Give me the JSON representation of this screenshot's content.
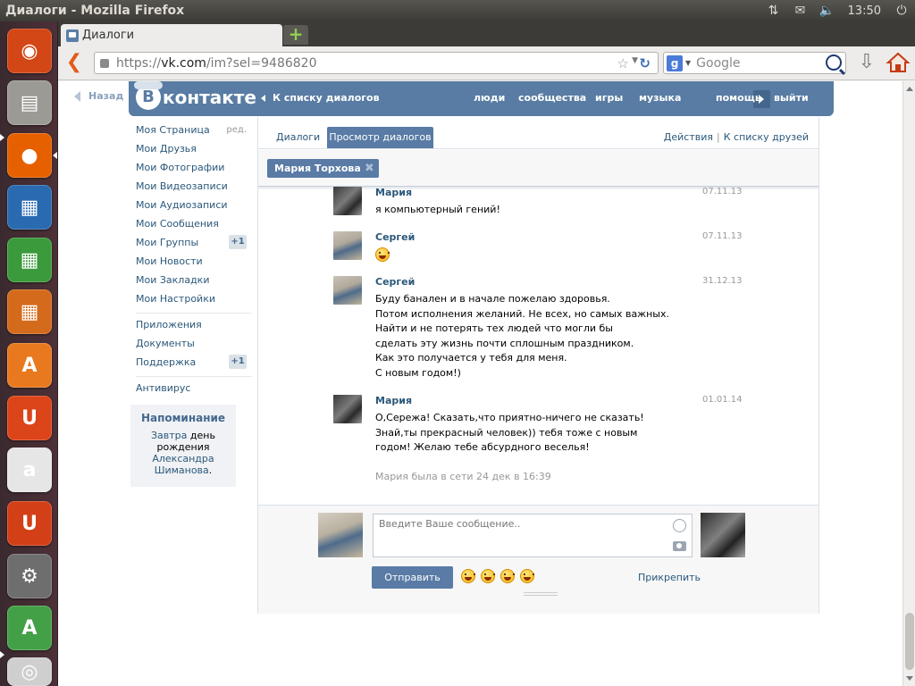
{
  "window": {
    "title": "Диалоги - Mozilla Firefox"
  },
  "tray": {
    "clock": "13:50"
  },
  "launcher": {
    "items": [
      {
        "name": "ubuntu-dash-icon",
        "bg": "#d34615",
        "glyph": "◉"
      },
      {
        "name": "files-icon",
        "bg": "#9c9a94",
        "glyph": "▤"
      },
      {
        "name": "firefox-icon",
        "bg": "#e66000",
        "glyph": "●"
      },
      {
        "name": "writer-icon",
        "bg": "#2a6ab0",
        "glyph": "▦"
      },
      {
        "name": "calc-icon",
        "bg": "#3b9a3b",
        "glyph": "▦"
      },
      {
        "name": "impress-icon",
        "bg": "#d46a1b",
        "glyph": "▦"
      },
      {
        "name": "software-center-icon",
        "bg": "#e8791e",
        "glyph": "A"
      },
      {
        "name": "ubuntu-one-icon",
        "bg": "#dc4419",
        "glyph": "U"
      },
      {
        "name": "amazon-icon",
        "bg": "#e6e6e6",
        "glyph": "a"
      },
      {
        "name": "ubuntu-one-music-icon",
        "bg": "#d33f16",
        "glyph": "U"
      },
      {
        "name": "system-settings-icon",
        "bg": "#6e6e6e",
        "glyph": "⚙"
      },
      {
        "name": "software-updater-icon",
        "bg": "#43a047",
        "glyph": "A"
      },
      {
        "name": "dvd-icon",
        "bg": "#cfcfcf",
        "glyph": "◎"
      }
    ]
  },
  "browser": {
    "tab_title": "Диалоги",
    "url_proto": "https://",
    "url_host": "vk.com",
    "url_rest": "/im?sel=9486820",
    "search_placeholder": "Google"
  },
  "vk": {
    "back": "Назад",
    "logo": "контакте",
    "logo_b": "В",
    "to_dialog_list": "К списку диалогов",
    "nav": [
      "люди",
      "сообщества",
      "игры",
      "музыка",
      "помощь",
      "выйти"
    ],
    "menu": {
      "edit": "ред.",
      "main": [
        "Моя Страница",
        "Мои Друзья",
        "Мои Фотографии",
        "Мои Видеозаписи",
        "Мои Аудиозаписи",
        "Мои Сообщения",
        "Мои Группы",
        "Мои Новости",
        "Мои Закладки",
        "Мои Настройки"
      ],
      "groups_badge": "+1",
      "apps": [
        "Приложения",
        "Документы",
        "Поддержка"
      ],
      "support_badge": "+1",
      "extra": "Антивирус"
    },
    "reminder": {
      "title": "Напоминание",
      "when": "Завтра",
      "text1": "день рождения",
      "who": "Александра Шиманова",
      "dot": "."
    },
    "dialog": {
      "tab_dialogs": "Диалоги",
      "tab_view": "Просмотр диалогов",
      "actions": "Действия",
      "to_friends": "К списку друзей",
      "chip": "Мария Торхова",
      "messages": [
        {
          "author": "Мария",
          "date": "07.11.13",
          "text": "я компьютерный гений!",
          "avatar": "maria"
        },
        {
          "author": "Сергей",
          "date": "07.11.13",
          "text": "",
          "emoji": true,
          "avatar": "sergey"
        },
        {
          "author": "Сергей",
          "date": "31.12.13",
          "text": "Буду банален и в начале пожелаю здоровья.\nПотом исполнения желаний. Не всех, но самых важных.\nНайти и не потерять тех людей что могли бы\nсделать эту жизнь почти сплошным праздником.\nКак это получается у тебя для меня.\nС новым годом!)",
          "avatar": "sergey"
        },
        {
          "author": "Мария",
          "date": "01.01.14",
          "text": "О,Сережа! Сказать,что приятно-ничего не сказать! Знай,ты прекрасный человек)) тебя тоже с новым годом! Желаю тебе абсурдного веселья!",
          "avatar": "maria"
        }
      ],
      "status": "Мария была в сети 24 дек в 16:39",
      "input_placeholder": "Введите Ваше сообщение..",
      "send": "Отправить",
      "attach": "Прикрепить"
    }
  }
}
